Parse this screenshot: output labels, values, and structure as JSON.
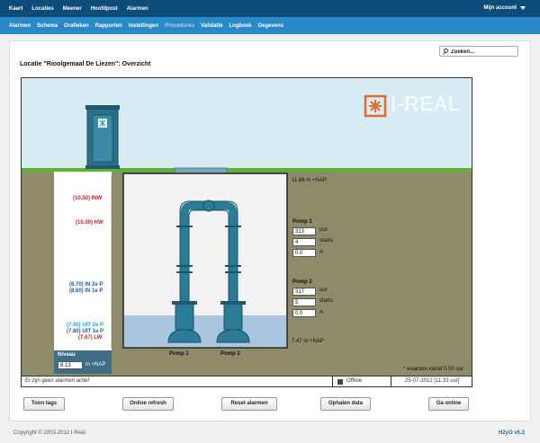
{
  "topnav": {
    "items": [
      "Kaart",
      "Locaties",
      "Meener",
      "Hoofdpost",
      "Alarmen"
    ],
    "account": "Mijn account"
  },
  "subnav": {
    "items": [
      "Alarmen",
      "Schema",
      "Grafieken",
      "Rapporten",
      "Instellingen",
      "Procedures",
      "Validatie",
      "Logboek",
      "Gegevens"
    ],
    "active_dim": "Procedures"
  },
  "search": {
    "placeholder": "Zoeken..."
  },
  "page": {
    "title": "Locatie \"Rioolgemaal De Liezen\": Overzicht"
  },
  "brand": {
    "logo_text": "I-REAL",
    "accent": "#e46a2c"
  },
  "scale_labels": {
    "inw": "(10.50)  INW",
    "hw": "(10.00)  HW",
    "in2": "(8.70)  IN 2e P",
    "in1": "(8.60)  IN 1e P",
    "uit2": "(7.90)  UIT 2e P",
    "uit1": "(7.80)  UIT 1e P",
    "lw": "(7.67)  LW"
  },
  "levels": {
    "top": "11.86  m +NAP",
    "bottom": "7.47  m +NAP"
  },
  "niveau": {
    "label": "Niveau",
    "value": "8.13",
    "unit": "m +NAP"
  },
  "pumps": [
    {
      "title": "Pomp 1",
      "hours": "313",
      "hours_unit": "uur",
      "starts": "4",
      "starts_unit": "starts",
      "amps": "0.0",
      "amps_unit": "A",
      "caption": "Pomp 1"
    },
    {
      "title": "Pomp 2",
      "hours": "317",
      "hours_unit": "uur",
      "starts": "5",
      "starts_unit": "starts",
      "amps": "0.0",
      "amps_unit": "A",
      "caption": "Pomp 2"
    }
  ],
  "note": "* waarden vanaf 0.00 uur",
  "statusbar": {
    "message": "Er zijn geen alarmen actief",
    "connection": "Offline",
    "timestamp": "25-07-2012 [11:33 uur]"
  },
  "buttons": {
    "toon_tags": "Toon tags",
    "online_refresh": "Online refresh",
    "reset_alarmen": "Reset alarmen",
    "ophalen_data": "Ophalen data",
    "ga_online": "Ga online"
  },
  "footer": {
    "copyright": "Copyright © 2003-2012 I-Real",
    "version": "H2yO v5.2"
  },
  "colors": {
    "topbar": "#0d4b78",
    "subbar": "#2a8ac7",
    "grass": "#58b82a",
    "soil": "#8f8a6a",
    "pipe": "#2b7b96",
    "water": "#a9c5df"
  }
}
